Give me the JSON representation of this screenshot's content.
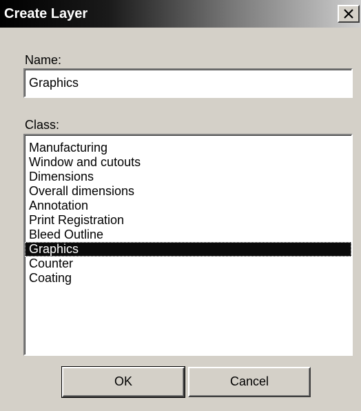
{
  "window": {
    "title": "Create Layer",
    "close_icon": "close-icon"
  },
  "name_field": {
    "label": "Name:",
    "value": "Graphics"
  },
  "class_list": {
    "label": "Class:",
    "selected": "Graphics",
    "items": [
      {
        "label": "Manufacturing"
      },
      {
        "label": "Window and cutouts"
      },
      {
        "label": "Dimensions"
      },
      {
        "label": "Overall dimensions"
      },
      {
        "label": "Annotation"
      },
      {
        "label": "Print Registration"
      },
      {
        "label": "Bleed Outline"
      },
      {
        "label": "Graphics"
      },
      {
        "label": "Counter"
      },
      {
        "label": "Coating"
      }
    ]
  },
  "buttons": {
    "ok_label": "OK",
    "cancel_label": "Cancel"
  },
  "colors": {
    "face": "#d4d0c8",
    "selection": "#0a0a0a",
    "title_start": "#000000",
    "title_end": "#cfcfcf"
  }
}
